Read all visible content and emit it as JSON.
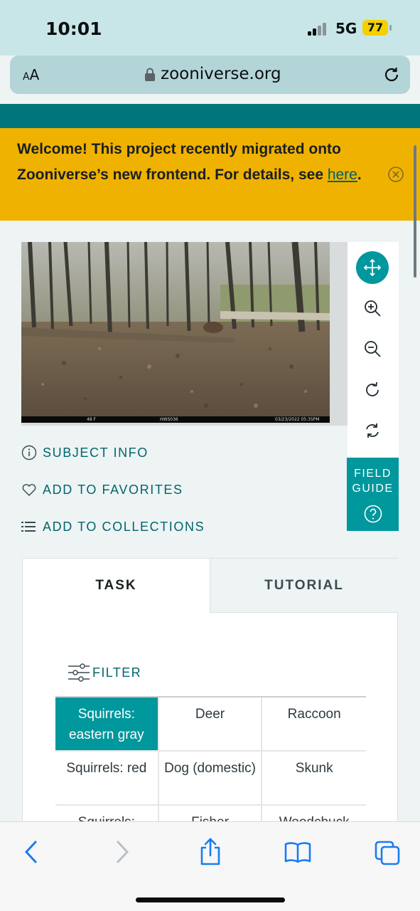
{
  "status": {
    "time": "10:01",
    "network": "5G",
    "battery": "77"
  },
  "browser": {
    "text_size_label": "AA",
    "url": "zooniverse.org"
  },
  "banner": {
    "text": "Welcome! This project recently migrated onto Zooniverse’s new frontend. For details, see ",
    "link": "here",
    "end": "."
  },
  "image_stamp": {
    "temperature": "48 F",
    "camera": "HWS036",
    "datetime": "03/23/2022  05:35PM"
  },
  "subject_actions": {
    "info": "SUBJECT INFO",
    "favorites": "ADD TO FAVORITES",
    "collections": "ADD TO COLLECTIONS"
  },
  "field_guide": {
    "line1": "FIELD",
    "line2": "GUIDE"
  },
  "tabs": {
    "task": "TASK",
    "tutorial": "TUTORIAL"
  },
  "filter_label": "FILTER",
  "choices": [
    [
      "Squirrels: eastern gray",
      "Deer",
      "Raccoon"
    ],
    [
      "Squirrels: red",
      "Dog (domestic)",
      "Skunk"
    ],
    [
      "Squirrels:",
      "Fisher",
      "Woodchuck"
    ]
  ],
  "colors": {
    "teal": "#00979d",
    "dark_teal": "#00757a",
    "banner": "#f0b200"
  }
}
